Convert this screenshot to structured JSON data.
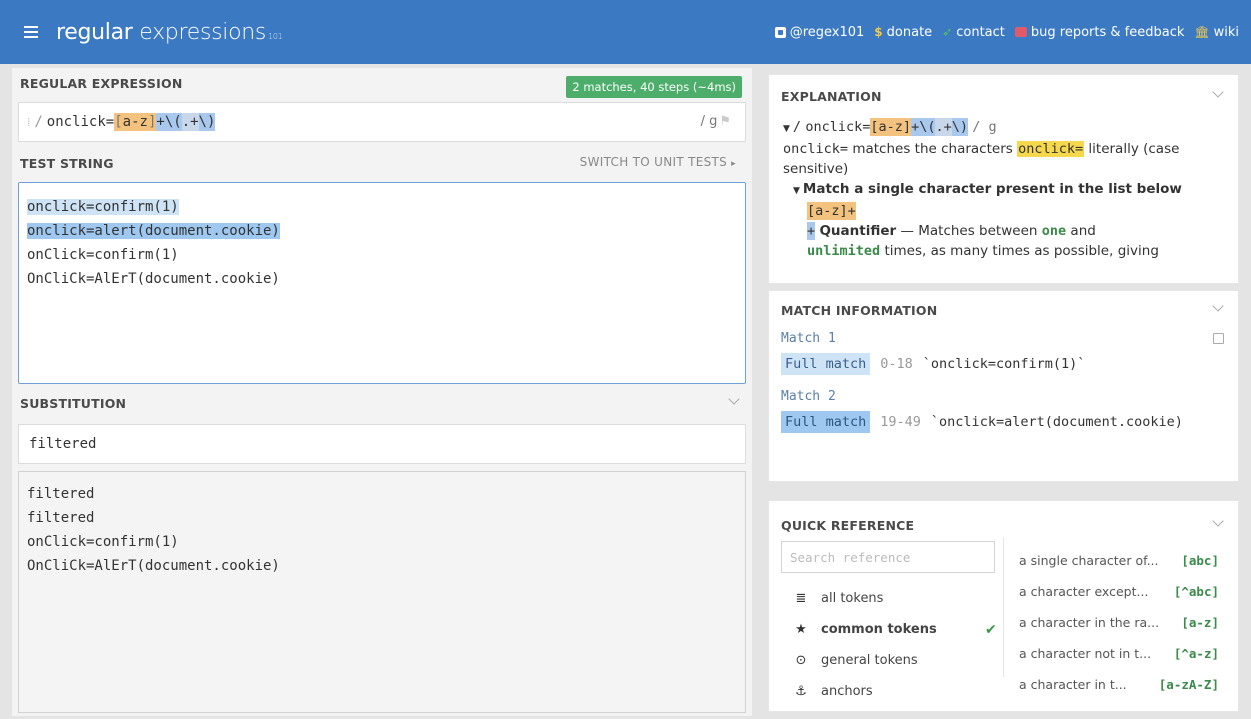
{
  "header": {
    "logo_regular": "regular",
    "logo_expressions": " expressions",
    "logo_version": "101",
    "links": {
      "twitter": "@regex101",
      "donate": "donate",
      "contact": "contact",
      "bugs": "bug reports & feedback",
      "wiki": "wiki"
    }
  },
  "regex_section": {
    "heading": "REGULAR EXPRESSION",
    "badge": "2 matches, 40 steps (~4ms)",
    "delimiter": "/",
    "pattern_literal": "onclick=",
    "pattern_class_open": "[",
    "pattern_class_body": "a-z",
    "pattern_class_close": "]",
    "pattern_quant": "+",
    "pattern_esc_open": "\\(",
    "pattern_group": ".+",
    "pattern_esc_close": "\\)",
    "flags": "/ g"
  },
  "test_section": {
    "heading": "TEST STRING",
    "unit_tests": "SWITCH TO UNIT TESTS",
    "lines": [
      "onclick=confirm(1)",
      "onclick=alert(document.cookie)",
      "onClick=confirm(1)",
      "OnCliCk=AlErT(document.cookie)"
    ]
  },
  "substitution_section": {
    "heading": "SUBSTITUTION",
    "value": "filtered",
    "result_lines": [
      "filtered",
      "filtered",
      "onClick=confirm(1)",
      "OnCliCk=AlErT(document.cookie)"
    ]
  },
  "explanation": {
    "heading": "EXPLANATION",
    "root_slash": "/",
    "root_flags": "/ g",
    "literal_token": "onclick=",
    "literal_desc_pre": " matches the characters ",
    "literal_desc_post": " literally (case sensitive)",
    "class_heading": "Match a single character present in the list below",
    "class_token": "[a-z]+",
    "quant_symbol": "+",
    "quant_label": "Quantifier",
    "quant_desc_1": " — Matches between ",
    "quant_one": "one",
    "quant_desc_2": " and ",
    "quant_unlimited": "unlimited",
    "quant_desc_3": " times, as many times as possible, giving"
  },
  "match_info": {
    "heading": "MATCH INFORMATION",
    "matches": [
      {
        "label": "Match 1",
        "kind": "Full match",
        "range": "0-18",
        "text": "`onclick=confirm(1)`"
      },
      {
        "label": "Match 2",
        "kind": "Full match",
        "range": "19-49",
        "text": "`onclick=alert(document.cookie)"
      }
    ]
  },
  "quick_reference": {
    "heading": "QUICK REFERENCE",
    "search_placeholder": "Search reference",
    "categories": [
      {
        "label": "all tokens",
        "icon": "database-icon"
      },
      {
        "label": "common tokens",
        "icon": "star-icon"
      },
      {
        "label": "general tokens",
        "icon": "target-icon"
      },
      {
        "label": "anchors",
        "icon": "anchor-icon"
      }
    ],
    "items": [
      {
        "desc": "a single character of...",
        "token": "[abc]"
      },
      {
        "desc": "a character except...",
        "token": "[^abc]"
      },
      {
        "desc": "a character in the ra...",
        "token": "[a-z]"
      },
      {
        "desc": "a character not in t...",
        "token": "[^a-z]"
      },
      {
        "desc": "a character in t...",
        "token": "[a-zA-Z]"
      }
    ]
  },
  "colors": {
    "header_bg": "#3b79c2",
    "badge_bg": "#4cae6a",
    "class_highlight": "#f3c27f",
    "match1_highlight": "#cfe3f6",
    "match2_highlight": "#9ec8f0",
    "literal_highlight": "#f6d84d"
  }
}
